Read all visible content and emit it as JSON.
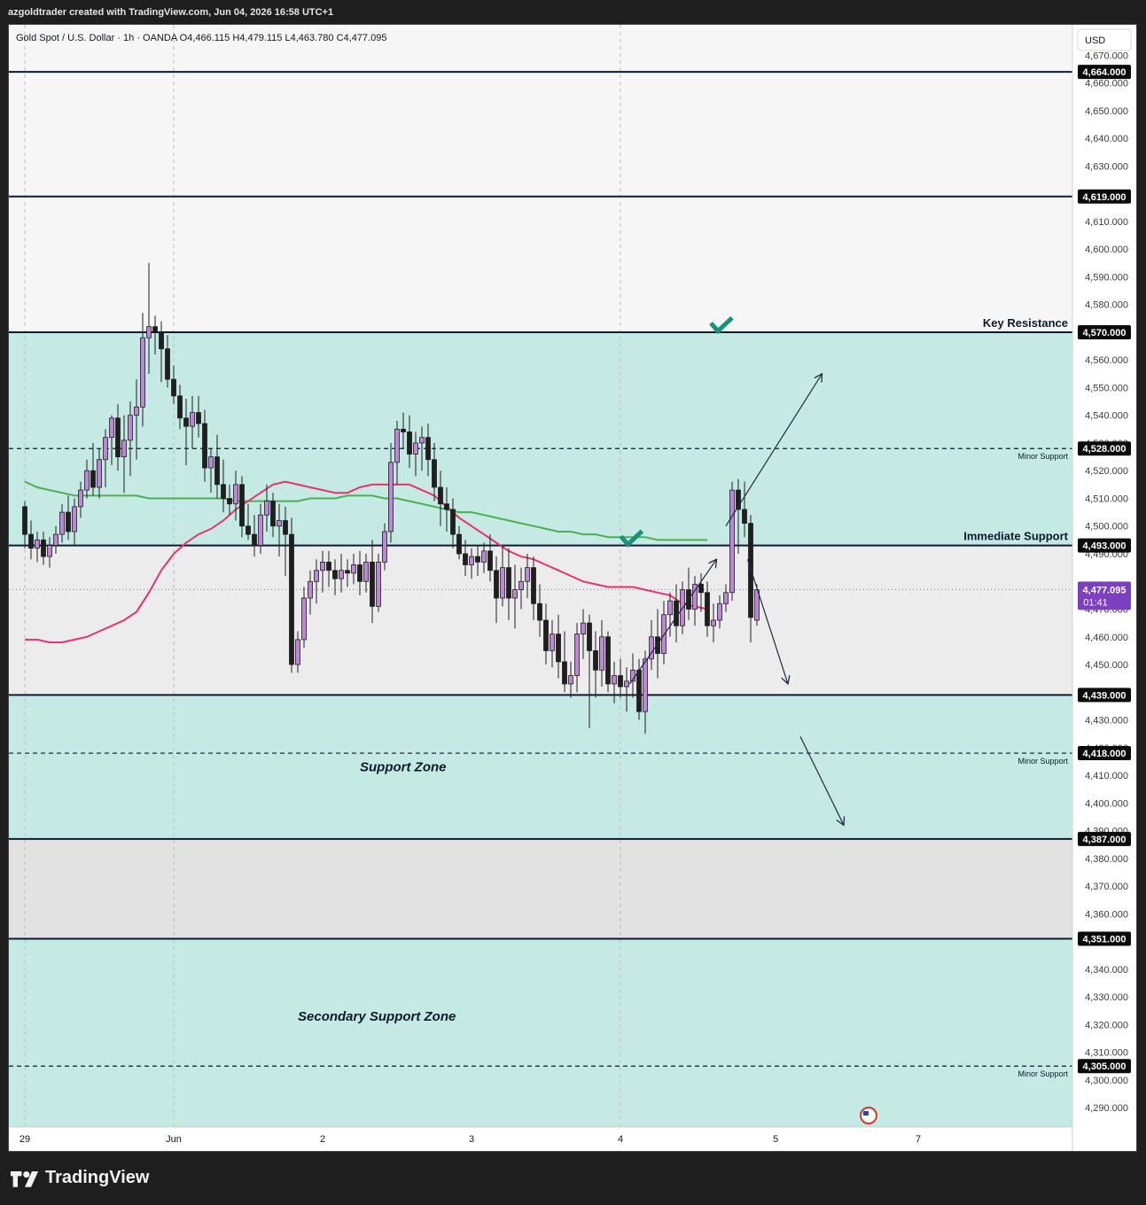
{
  "header": {
    "credit": "azgoldtrader created with TradingView.com, Jun 04, 2026 16:58 UTC+1"
  },
  "legend": {
    "text": "Gold Spot / U.S. Dollar · 1h · OANDA  O4,466.115  H4,479.115  L4,463.780  C4,477.095"
  },
  "footer": {
    "brand": "TradingView"
  },
  "colors": {
    "zone_teal": "#c5eae3",
    "zone_grey_light": "#f6f6f6",
    "zone_grey_mid": "#ececec",
    "zone_grey_dark": "#e2e2e2",
    "ma_red": "#e8336b",
    "ma_green": "#4caf50",
    "candle_bull": "#bd87d6",
    "candle_bear": "#1f1f1f",
    "line_dark": "#0c1b33",
    "check_green": "#16937a",
    "price_tag_purple": "#7b3fbf"
  },
  "chart_data": {
    "type": "candlestick",
    "title": "Gold Spot / U.S. Dollar · 1h · OANDA",
    "currency": "USD",
    "ylim": [
      4283,
      4681
    ],
    "y_ticks": [
      4290,
      4300,
      4310,
      4320,
      4330,
      4340,
      4360,
      4370,
      4380,
      4400,
      4410,
      4430,
      4450,
      4460,
      4500,
      4510,
      4520,
      4540,
      4550,
      4560,
      4580,
      4590,
      4600,
      4610,
      4630,
      4640,
      4650,
      4660
    ],
    "y_ticks_partial": [
      4390,
      4420,
      4470,
      4490,
      4530,
      4670
    ],
    "x_labels": [
      {
        "label": "29",
        "x": 0
      },
      {
        "label": "Jun",
        "x": 24
      },
      {
        "label": "2",
        "x": 48
      },
      {
        "label": "3",
        "x": 72
      },
      {
        "label": "4",
        "x": 96
      },
      {
        "label": "5",
        "x": 121
      },
      {
        "label": "7",
        "x": 144
      }
    ],
    "dashed_verticals": [
      0,
      24,
      96
    ],
    "zones": [
      {
        "from": 4493,
        "to": 4570,
        "color": "teal"
      },
      {
        "from": 4387,
        "to": 4439,
        "color": "teal"
      },
      {
        "from": 4283,
        "to": 4351,
        "color": "teal"
      },
      {
        "from": 4570,
        "to": 4681,
        "color": "grey_light"
      },
      {
        "from": 4439,
        "to": 4493,
        "color": "grey_mid"
      },
      {
        "from": 4351,
        "to": 4387,
        "color": "grey_dark"
      }
    ],
    "levels": [
      {
        "price": 4664,
        "label": "4,664.000",
        "style": "solid"
      },
      {
        "price": 4619,
        "label": "4,619.000",
        "style": "solid"
      },
      {
        "price": 4570,
        "label": "4,570.000",
        "style": "solid",
        "name": "Key Resistance"
      },
      {
        "price": 4528,
        "label": "4,528.000",
        "style": "dashed",
        "name": "Minor Support"
      },
      {
        "price": 4493,
        "label": "4,493.000",
        "style": "solid",
        "name": "Immediate Support"
      },
      {
        "price": 4439,
        "label": "4,439.000",
        "style": "solid"
      },
      {
        "price": 4418,
        "label": "4,418.000",
        "style": "dashed",
        "name": "Minor Support"
      },
      {
        "price": 4387,
        "label": "4,387.000",
        "style": "solid"
      },
      {
        "price": 4351,
        "label": "4,351.000",
        "style": "solid"
      },
      {
        "price": 4305,
        "label": "4,305.000",
        "style": "dashed",
        "name": "Minor Support"
      }
    ],
    "zone_labels": [
      {
        "text": "Support Zone",
        "price": 4413,
        "x": 54
      },
      {
        "text": "Secondary Support Zone",
        "price": 4323,
        "x": 44
      }
    ],
    "last_price": {
      "value": 4477.095,
      "label": "4,477.095",
      "countdown": "01:41"
    },
    "candles": [
      [
        4507,
        4509,
        4492,
        4497
      ],
      [
        4497,
        4502,
        4488,
        4492
      ],
      [
        4492,
        4498,
        4487,
        4495
      ],
      [
        4495,
        4498,
        4486,
        4489
      ],
      [
        4489,
        4496,
        4485,
        4493
      ],
      [
        4493,
        4500,
        4490,
        4497
      ],
      [
        4497,
        4508,
        4494,
        4505
      ],
      [
        4505,
        4511,
        4495,
        4498
      ],
      [
        4498,
        4510,
        4493,
        4507
      ],
      [
        4507,
        4516,
        4503,
        4513
      ],
      [
        4513,
        4524,
        4510,
        4520
      ],
      [
        4520,
        4530,
        4511,
        4514
      ],
      [
        4514,
        4528,
        4510,
        4524
      ],
      [
        4524,
        4535,
        4514,
        4532
      ],
      [
        4532,
        4540,
        4522,
        4539
      ],
      [
        4539,
        4544,
        4520,
        4525
      ],
      [
        4525,
        4540,
        4512,
        4531
      ],
      [
        4531,
        4545,
        4518,
        4540
      ],
      [
        4540,
        4553,
        4524,
        4543
      ],
      [
        4543,
        4577,
        4536,
        4568
      ],
      [
        4568,
        4595,
        4555,
        4572
      ],
      [
        4572,
        4576,
        4562,
        4570
      ],
      [
        4570,
        4574,
        4552,
        4564
      ],
      [
        4564,
        4569,
        4550,
        4553
      ],
      [
        4553,
        4558,
        4544,
        4547
      ],
      [
        4547,
        4551,
        4535,
        4539
      ],
      [
        4539,
        4546,
        4522,
        4536
      ],
      [
        4536,
        4547,
        4528,
        4541
      ],
      [
        4541,
        4547,
        4532,
        4537
      ],
      [
        4537,
        4542,
        4516,
        4521
      ],
      [
        4521,
        4528,
        4512,
        4525
      ],
      [
        4525,
        4533,
        4510,
        4515
      ],
      [
        4515,
        4524,
        4505,
        4510
      ],
      [
        4510,
        4515,
        4504,
        4508
      ],
      [
        4508,
        4520,
        4502,
        4515
      ],
      [
        4515,
        4518,
        4496,
        4500
      ],
      [
        4500,
        4508,
        4495,
        4497
      ],
      [
        4497,
        4504,
        4489,
        4493
      ],
      [
        4493,
        4508,
        4490,
        4504
      ],
      [
        4504,
        4515,
        4498,
        4509
      ],
      [
        4509,
        4512,
        4496,
        4500
      ],
      [
        4500,
        4508,
        4489,
        4502
      ],
      [
        4502,
        4507,
        4482,
        4497
      ],
      [
        4497,
        4503,
        4447,
        4450
      ],
      [
        4450,
        4462,
        4447,
        4459
      ],
      [
        4459,
        4478,
        4456,
        4474
      ],
      [
        4474,
        4484,
        4468,
        4480
      ],
      [
        4480,
        4488,
        4472,
        4484
      ],
      [
        4484,
        4491,
        4476,
        4487
      ],
      [
        4487,
        4491,
        4478,
        4484
      ],
      [
        4484,
        4488,
        4475,
        4481
      ],
      [
        4481,
        4490,
        4476,
        4484
      ],
      [
        4484,
        4488,
        4478,
        4483
      ],
      [
        4483,
        4490,
        4479,
        4486
      ],
      [
        4486,
        4491,
        4475,
        4480
      ],
      [
        4480,
        4490,
        4476,
        4487
      ],
      [
        4487,
        4495,
        4465,
        4471
      ],
      [
        4471,
        4490,
        4469,
        4487
      ],
      [
        4487,
        4501,
        4484,
        4498
      ],
      [
        4498,
        4530,
        4494,
        4523
      ],
      [
        4523,
        4538,
        4515,
        4535
      ],
      [
        4535,
        4541,
        4528,
        4534
      ],
      [
        4534,
        4540,
        4521,
        4526
      ],
      [
        4526,
        4534,
        4518,
        4530
      ],
      [
        4530,
        4536,
        4520,
        4532
      ],
      [
        4532,
        4537,
        4518,
        4524
      ],
      [
        4524,
        4530,
        4509,
        4514
      ],
      [
        4514,
        4520,
        4500,
        4508
      ],
      [
        4508,
        4514,
        4498,
        4506
      ],
      [
        4506,
        4510,
        4492,
        4497
      ],
      [
        4497,
        4500,
        4488,
        4490
      ],
      [
        4490,
        4495,
        4482,
        4486
      ],
      [
        4486,
        4492,
        4481,
        4489
      ],
      [
        4489,
        4493,
        4482,
        4487
      ],
      [
        4487,
        4494,
        4483,
        4491
      ],
      [
        4491,
        4497,
        4480,
        4484
      ],
      [
        4484,
        4489,
        4465,
        4474
      ],
      [
        4474,
        4493,
        4471,
        4485
      ],
      [
        4485,
        4492,
        4466,
        4474
      ],
      [
        4474,
        4486,
        4463,
        4477
      ],
      [
        4477,
        4485,
        4470,
        4480
      ],
      [
        4480,
        4490,
        4474,
        4485
      ],
      [
        4485,
        4489,
        4466,
        4472
      ],
      [
        4472,
        4479,
        4460,
        4466
      ],
      [
        4466,
        4472,
        4450,
        4455
      ],
      [
        4455,
        4466,
        4449,
        4461
      ],
      [
        4461,
        4468,
        4445,
        4451
      ],
      [
        4451,
        4462,
        4440,
        4443
      ],
      [
        4443,
        4451,
        4438,
        4446
      ],
      [
        4446,
        4465,
        4440,
        4461
      ],
      [
        4461,
        4470,
        4452,
        4465
      ],
      [
        4465,
        4468,
        4427,
        4455
      ],
      [
        4455,
        4462,
        4438,
        4448
      ],
      [
        4448,
        4466,
        4442,
        4460
      ],
      [
        4460,
        4462,
        4440,
        4443
      ],
      [
        4443,
        4451,
        4436,
        4446
      ],
      [
        4446,
        4452,
        4438,
        4442
      ],
      [
        4442,
        4449,
        4433,
        4444
      ],
      [
        4444,
        4454,
        4438,
        4448
      ],
      [
        4448,
        4452,
        4430,
        4433
      ],
      [
        4433,
        4455,
        4425,
        4452
      ],
      [
        4452,
        4466,
        4448,
        4460
      ],
      [
        4460,
        4470,
        4445,
        4454
      ],
      [
        4454,
        4473,
        4450,
        4468
      ],
      [
        4468,
        4476,
        4460,
        4473
      ],
      [
        4473,
        4479,
        4458,
        4464
      ],
      [
        4464,
        4480,
        4461,
        4477
      ],
      [
        4477,
        4485,
        4466,
        4470
      ],
      [
        4470,
        4482,
        4464,
        4479
      ],
      [
        4479,
        4483,
        4469,
        4476
      ],
      [
        4476,
        4480,
        4460,
        4464
      ],
      [
        4464,
        4472,
        4458,
        4466
      ],
      [
        4466,
        4475,
        4463,
        4472
      ],
      [
        4472,
        4479,
        4469,
        4476
      ],
      [
        4476,
        4516,
        4473,
        4513
      ],
      [
        4513,
        4517,
        4490,
        4506
      ],
      [
        4506,
        4516,
        4496,
        4501
      ],
      [
        4501,
        4504,
        4458,
        4467
      ],
      [
        4466,
        4479,
        4464,
        4477
      ]
    ],
    "ma_red": [
      [
        0,
        4459
      ],
      [
        2,
        4459
      ],
      [
        4,
        4458
      ],
      [
        6,
        4458
      ],
      [
        8,
        4459
      ],
      [
        10,
        4460
      ],
      [
        12,
        4462
      ],
      [
        14,
        4464
      ],
      [
        16,
        4466
      ],
      [
        18,
        4469
      ],
      [
        20,
        4476
      ],
      [
        22,
        4484
      ],
      [
        24,
        4490
      ],
      [
        26,
        4494
      ],
      [
        28,
        4497
      ],
      [
        30,
        4499
      ],
      [
        32,
        4502
      ],
      [
        34,
        4506
      ],
      [
        36,
        4509
      ],
      [
        38,
        4512
      ],
      [
        40,
        4515
      ],
      [
        42,
        4516
      ],
      [
        44,
        4515
      ],
      [
        46,
        4514
      ],
      [
        48,
        4513
      ],
      [
        50,
        4512
      ],
      [
        52,
        4512
      ],
      [
        54,
        4514
      ],
      [
        56,
        4515
      ],
      [
        58,
        4515
      ],
      [
        60,
        4515
      ],
      [
        62,
        4515
      ],
      [
        64,
        4513
      ],
      [
        66,
        4511
      ],
      [
        68,
        4507
      ],
      [
        70,
        4503
      ],
      [
        72,
        4500
      ],
      [
        74,
        4497
      ],
      [
        76,
        4494
      ],
      [
        78,
        4491
      ],
      [
        80,
        4489
      ],
      [
        82,
        4488
      ],
      [
        84,
        4486
      ],
      [
        86,
        4484
      ],
      [
        88,
        4482
      ],
      [
        90,
        4480
      ],
      [
        92,
        4479
      ],
      [
        94,
        4478
      ],
      [
        96,
        4478
      ],
      [
        98,
        4478
      ],
      [
        100,
        4477
      ],
      [
        102,
        4476
      ],
      [
        104,
        4475
      ],
      [
        106,
        4472
      ],
      [
        108,
        4471
      ],
      [
        110,
        4470
      ]
    ],
    "ma_green": [
      [
        0,
        4516
      ],
      [
        2,
        4514
      ],
      [
        4,
        4513
      ],
      [
        6,
        4512
      ],
      [
        8,
        4511
      ],
      [
        10,
        4511
      ],
      [
        12,
        4511
      ],
      [
        14,
        4511
      ],
      [
        16,
        4511
      ],
      [
        18,
        4511
      ],
      [
        20,
        4510
      ],
      [
        22,
        4510
      ],
      [
        24,
        4510
      ],
      [
        26,
        4510
      ],
      [
        28,
        4510
      ],
      [
        30,
        4510
      ],
      [
        32,
        4510
      ],
      [
        34,
        4509
      ],
      [
        36,
        4509
      ],
      [
        38,
        4509
      ],
      [
        40,
        4509
      ],
      [
        42,
        4509
      ],
      [
        44,
        4509
      ],
      [
        46,
        4510
      ],
      [
        48,
        4510
      ],
      [
        50,
        4510
      ],
      [
        52,
        4511
      ],
      [
        54,
        4511
      ],
      [
        56,
        4511
      ],
      [
        58,
        4510
      ],
      [
        60,
        4510
      ],
      [
        62,
        4509
      ],
      [
        64,
        4508
      ],
      [
        66,
        4507
      ],
      [
        68,
        4506
      ],
      [
        70,
        4505
      ],
      [
        72,
        4505
      ],
      [
        74,
        4504
      ],
      [
        76,
        4503
      ],
      [
        78,
        4502
      ],
      [
        80,
        4501
      ],
      [
        82,
        4500
      ],
      [
        84,
        4499
      ],
      [
        86,
        4498
      ],
      [
        88,
        4498
      ],
      [
        90,
        4497
      ],
      [
        92,
        4497
      ],
      [
        94,
        4496
      ],
      [
        96,
        4496
      ],
      [
        98,
        4496
      ],
      [
        100,
        4496
      ],
      [
        102,
        4495
      ],
      [
        104,
        4495
      ],
      [
        106,
        4495
      ],
      [
        108,
        4495
      ],
      [
        110,
        4495
      ]
    ],
    "arrows": [
      {
        "from": [
          97.5,
          4443
        ],
        "to": [
          111.5,
          4488
        ]
      },
      {
        "from": [
          113,
          4500
        ],
        "to": [
          128.5,
          4555
        ]
      },
      {
        "from": [
          116.5,
          4488
        ],
        "to": [
          123,
          4443
        ]
      },
      {
        "from": [
          125,
          4424
        ],
        "to": [
          132,
          4392
        ]
      }
    ],
    "checkmarks": [
      {
        "x": 112,
        "price": 4572
      },
      {
        "x": 97.5,
        "price": 4495
      }
    ]
  }
}
